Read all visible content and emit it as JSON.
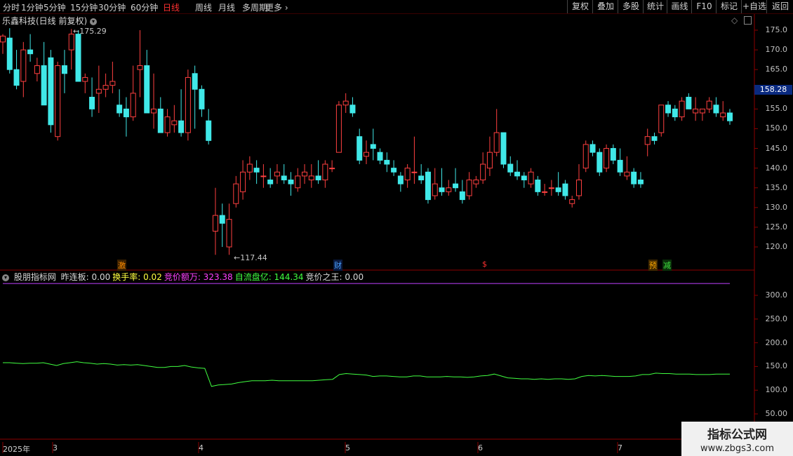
{
  "toolbar": {
    "periods": [
      "分时",
      "1分钟",
      "5分钟",
      "15分钟",
      "30分钟",
      "60分钟",
      "日线",
      "周线",
      "月线",
      "多周期",
      "更多"
    ],
    "active_period": "日线",
    "more_arrow": "›",
    "right_buttons": [
      "复权",
      "叠加",
      "多股",
      "统计",
      "画线",
      "F10",
      "标记",
      "+自选",
      "返回"
    ]
  },
  "chart_title": "乐鑫科技(日线 前复权)",
  "high_label": "175.29",
  "low_label": "117.44",
  "current_price": "158.28",
  "price_axis": [
    "175.0",
    "170.0",
    "165.0",
    "160.0",
    "155.0",
    "150.0",
    "145.0",
    "140.0",
    "135.0",
    "130.0",
    "125.0",
    "120.0"
  ],
  "markers": [
    {
      "text": "激",
      "color": "#ff8c00",
      "bg": "#3a2000"
    },
    {
      "text": "财",
      "color": "#4aa0ff",
      "bg": "#0a1a40"
    },
    {
      "text": "$",
      "color": "#ff3030",
      "bg": "#000"
    },
    {
      "text": "预",
      "color": "#ffaa00",
      "bg": "#402800"
    },
    {
      "text": "减",
      "color": "#40e040",
      "bg": "#0a300a"
    }
  ],
  "indicator": {
    "name": "股朋指标网",
    "items": [
      {
        "label": "昨连板:",
        "value": "0.00",
        "color": "#d8d8d8"
      },
      {
        "label": "换手率:",
        "value": "0.02",
        "color": "#ffff40"
      },
      {
        "label": "竞价额万:",
        "value": "323.38",
        "color": "#ff40ff"
      },
      {
        "label": "自流盘亿:",
        "value": "144.34",
        "color": "#40ff40"
      },
      {
        "label": "竞价之王:",
        "value": "0.00",
        "color": "#d8d8d8"
      }
    ],
    "axis": [
      "300.0",
      "250.0",
      "200.0",
      "150.0",
      "100.0",
      "50.00"
    ]
  },
  "time_axis": [
    "2025年",
    "3",
    "4",
    "5",
    "6",
    "7"
  ],
  "watermark": {
    "line1": "指标公式网",
    "line2": "www.zbgs3.com"
  },
  "chart_data": {
    "type": "candlestick",
    "ylim": [
      115,
      178
    ],
    "candles": [
      [
        172,
        174,
        169,
        173.5
      ],
      [
        173,
        175.5,
        164,
        165
      ],
      [
        165,
        170,
        160,
        161
      ],
      [
        162,
        172,
        158,
        170
      ],
      [
        170,
        174,
        167,
        169
      ],
      [
        164,
        168,
        162,
        166
      ],
      [
        166,
        172,
        156,
        156
      ],
      [
        168,
        170,
        149,
        151
      ],
      [
        148,
        167,
        147,
        166
      ],
      [
        166,
        170,
        159,
        164
      ],
      [
        170,
        175.29,
        165,
        174
      ],
      [
        174,
        175,
        162,
        162
      ],
      [
        162,
        164,
        159,
        163
      ],
      [
        158,
        163,
        153,
        155
      ],
      [
        159,
        166,
        154,
        160
      ],
      [
        160,
        164,
        158,
        161
      ],
      [
        161,
        167,
        159,
        162
      ],
      [
        156,
        160,
        153,
        154
      ],
      [
        155,
        158,
        148,
        153
      ],
      [
        153,
        166,
        152,
        159
      ],
      [
        165,
        175,
        158,
        166
      ],
      [
        166,
        170,
        154,
        154
      ],
      [
        154,
        164,
        150,
        155
      ],
      [
        155,
        158,
        149,
        149
      ],
      [
        149,
        155,
        148,
        153
      ],
      [
        151,
        156,
        149,
        152
      ],
      [
        152,
        160,
        148,
        149
      ],
      [
        149,
        165,
        147,
        163
      ],
      [
        164,
        166,
        150,
        160
      ],
      [
        160,
        161,
        153,
        155
      ],
      [
        152,
        155,
        146,
        147
      ],
      [
        124,
        135,
        118,
        128
      ],
      [
        128,
        131,
        120,
        126
      ],
      [
        120,
        131,
        118,
        127
      ],
      [
        131,
        138,
        130,
        136
      ],
      [
        134,
        142,
        132,
        139
      ],
      [
        139,
        143,
        137,
        141
      ],
      [
        140,
        142,
        136,
        139
      ],
      [
        138,
        141,
        135,
        138
      ],
      [
        137,
        140,
        135,
        136
      ],
      [
        138,
        141,
        136,
        139
      ],
      [
        138,
        141,
        136,
        137
      ],
      [
        137,
        139,
        133,
        136
      ],
      [
        135,
        140,
        134,
        138
      ],
      [
        138,
        141,
        136,
        139
      ],
      [
        137,
        141,
        135,
        138
      ],
      [
        138,
        142,
        136,
        137
      ],
      [
        137,
        142,
        135,
        141
      ],
      [
        140,
        142,
        139,
        140
      ],
      [
        144,
        157,
        144,
        156
      ],
      [
        156,
        159,
        154,
        157
      ],
      [
        156,
        158,
        153,
        154
      ],
      [
        148,
        150,
        141,
        142
      ],
      [
        143,
        147,
        141,
        144
      ],
      [
        146,
        150,
        142,
        145
      ],
      [
        144,
        145,
        141,
        142
      ],
      [
        142,
        144,
        139,
        141
      ],
      [
        140,
        142,
        138,
        139
      ],
      [
        138,
        139,
        134,
        136
      ],
      [
        137,
        141,
        135,
        140
      ],
      [
        139,
        148,
        136,
        139
      ],
      [
        138,
        141,
        136,
        137
      ],
      [
        139,
        140,
        131,
        132
      ],
      [
        133,
        140,
        132,
        136
      ],
      [
        135,
        140,
        133,
        134
      ],
      [
        134,
        137,
        133,
        135
      ],
      [
        136,
        140,
        134,
        135
      ],
      [
        134,
        137,
        131,
        132
      ],
      [
        133,
        139,
        132,
        137
      ],
      [
        136,
        138,
        135,
        137
      ],
      [
        137,
        144,
        136,
        141
      ],
      [
        140,
        148,
        138,
        144
      ],
      [
        144,
        155,
        143,
        149
      ],
      [
        149,
        149,
        140,
        141
      ],
      [
        141,
        143,
        138,
        139
      ],
      [
        139,
        142,
        137,
        138
      ],
      [
        138,
        139,
        135,
        137
      ],
      [
        136,
        140,
        135,
        139
      ],
      [
        137,
        138,
        133,
        134
      ],
      [
        134,
        136,
        133,
        134
      ],
      [
        135,
        137,
        133,
        135
      ],
      [
        135,
        139,
        133,
        134
      ],
      [
        136,
        137,
        132,
        133
      ],
      [
        131,
        133,
        130,
        132
      ],
      [
        133,
        141,
        132,
        137
      ],
      [
        140,
        147,
        139,
        146
      ],
      [
        146,
        147,
        143,
        144
      ],
      [
        144,
        145,
        138,
        139
      ],
      [
        140,
        146,
        139,
        145
      ],
      [
        145,
        146,
        141,
        142
      ],
      [
        142,
        145,
        138,
        139
      ],
      [
        138,
        143,
        137,
        139
      ],
      [
        139,
        140,
        135,
        136
      ],
      [
        137,
        139,
        135,
        136
      ],
      [
        146,
        150,
        143,
        148
      ],
      [
        148,
        149,
        146,
        147
      ],
      [
        149,
        156,
        148,
        156
      ],
      [
        156,
        157,
        153,
        154
      ],
      [
        155,
        156,
        152,
        153
      ],
      [
        153,
        158,
        152,
        157
      ],
      [
        158,
        159,
        155,
        155
      ],
      [
        154,
        158,
        152,
        155
      ],
      [
        154,
        155,
        152,
        155
      ],
      [
        155,
        158,
        154,
        157
      ],
      [
        156,
        158,
        153,
        154
      ],
      [
        153,
        157,
        152,
        154
      ],
      [
        154,
        155,
        151,
        152
      ]
    ],
    "indicator_series": {
      "name": "自流盘亿",
      "values": [
        158,
        158,
        157,
        156,
        157,
        157,
        158,
        155,
        152,
        156,
        158,
        160,
        158,
        157,
        155,
        156,
        155,
        153,
        154,
        153,
        154,
        152,
        150,
        148,
        148,
        150,
        150,
        152,
        149,
        147,
        146,
        108,
        111,
        112,
        113,
        116,
        118,
        120,
        120,
        120,
        121,
        120,
        120,
        120,
        120,
        120,
        120,
        121,
        122,
        123,
        133,
        135,
        134,
        133,
        132,
        129,
        130,
        130,
        129,
        128,
        128,
        130,
        130,
        128,
        128,
        128,
        129,
        128,
        128,
        127,
        128,
        130,
        131,
        134,
        130,
        126,
        125,
        124,
        124,
        123,
        124,
        123,
        124,
        124,
        123,
        124,
        129,
        131,
        130,
        131,
        130,
        129,
        129,
        129,
        130,
        133,
        133,
        136,
        135,
        135,
        134,
        134,
        134,
        133,
        133,
        133,
        134,
        134,
        134
      ]
    },
    "indicator_ylim": [
      25,
      345
    ],
    "reference_line": 325
  }
}
